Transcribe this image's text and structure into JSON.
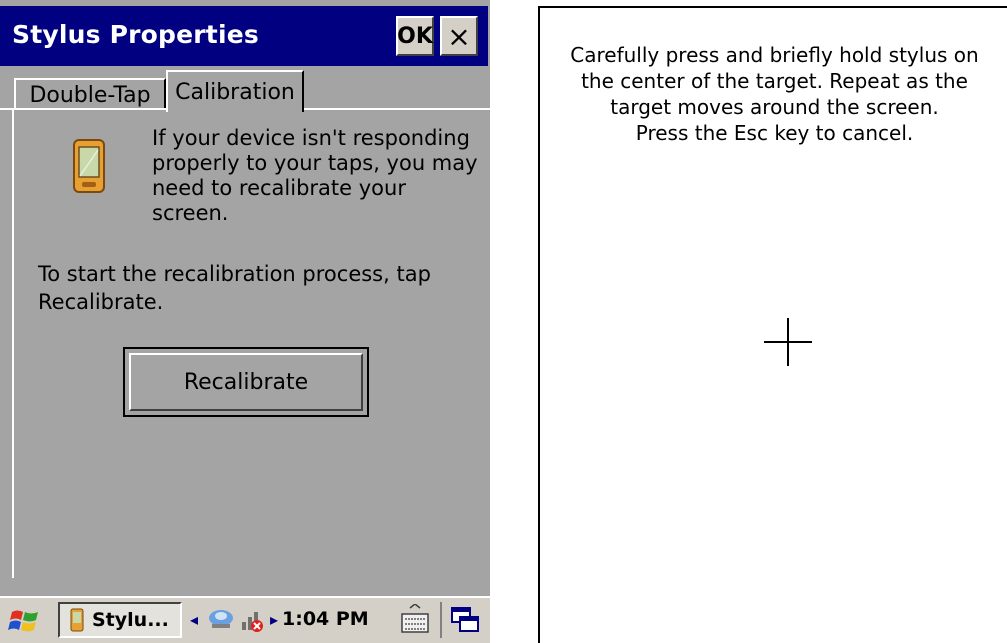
{
  "window": {
    "title": "Stylus Properties",
    "ok_label": "OK",
    "close_label": "×"
  },
  "tabs": [
    {
      "label": "Double-Tap",
      "selected": false
    },
    {
      "label": "Calibration",
      "selected": true
    }
  ],
  "calibration_tab": {
    "message": "If your device isn't responding properly to your taps, you may need to recalibrate your screen.",
    "instruction": "To start the recalibration process, tap Recalibrate.",
    "recalibrate_button": "Recalibrate"
  },
  "taskbar": {
    "task_label": "Stylu...",
    "clock": "1:04 PM",
    "tray_left_arrow": "◂",
    "tray_right_arrow": "▸"
  },
  "calibration_screen": {
    "line1": "Carefully press and briefly hold stylus on",
    "line2": "the center of the target. Repeat as the",
    "line3": "target moves around the screen.",
    "line4": "Press the Esc key to cancel."
  },
  "icons": {
    "device": "pocket-pc-icon",
    "start": "windows-flag-icon",
    "network": "network-icon",
    "signal": "signal-off-icon",
    "keyboard": "keyboard-icon",
    "desktop": "desktop-icon",
    "target": "crosshair-icon"
  },
  "colors": {
    "titlebar": "#000080",
    "dialog_bg": "#a4a4a4",
    "taskbar_bg": "#d4d0c8"
  }
}
